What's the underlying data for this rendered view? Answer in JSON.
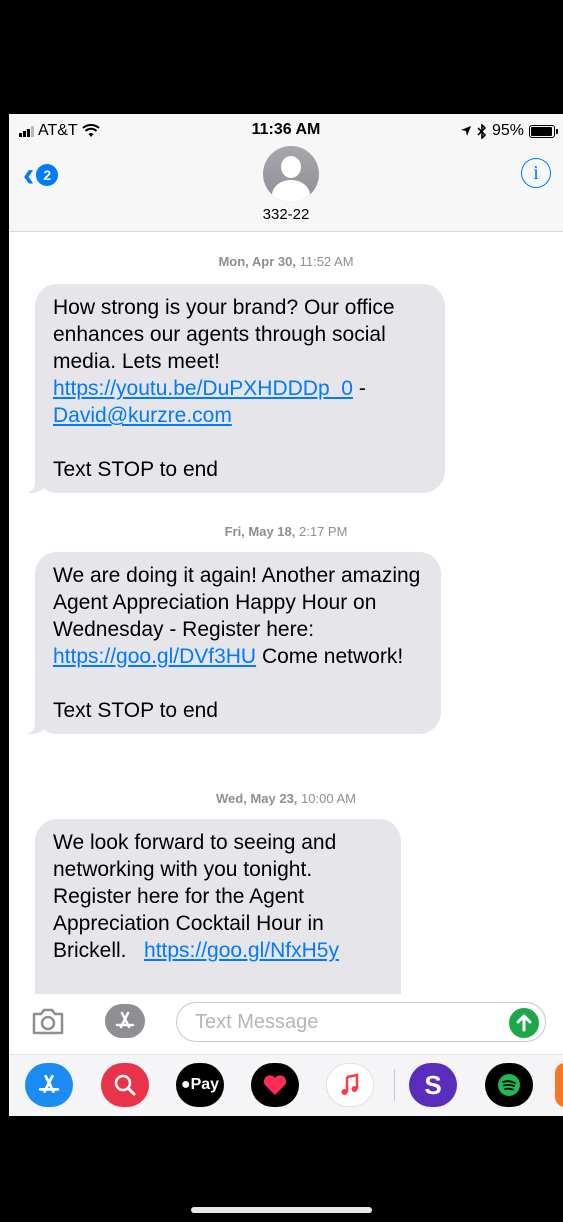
{
  "status_bar": {
    "carrier": "AT&T",
    "time": "11:36 AM",
    "battery": "95%",
    "battery_level": 0.95,
    "icons": [
      "signal-icon",
      "wifi-icon",
      "location-icon",
      "bluetooth-icon",
      "battery-icon"
    ]
  },
  "header": {
    "back_badge": "2",
    "contact_name": "332-22",
    "info_label": "i"
  },
  "messages": [
    {
      "timestamp_day": "Mon, Apr 30,",
      "timestamp_time": "11:52 AM",
      "text_before_link": "How strong is your brand? Our office enhances our agents through social media. Lets meet! ",
      "link1": "https://youtu.be/DuPXHDDDp_0",
      "text_between": " - ",
      "link2": "David@kurzre.com",
      "footer": "Text STOP to end"
    },
    {
      "timestamp_day": "Fri, May 18,",
      "timestamp_time": "2:17 PM",
      "text_before_link": "We are doing it again! Another amazing Agent Appreciation Happy Hour on Wednesday - Register here: ",
      "link1": "https://goo.gl/DVf3HU",
      "text_after_link": " Come network!",
      "footer": "Text STOP to end"
    },
    {
      "timestamp_day": "Wed, May 23,",
      "timestamp_time": "10:00 AM",
      "text_before_link": "We look forward to seeing and networking with you tonight. Register here for the Agent Appreciation Cocktail Hour in Brickell.   ",
      "link1": "https://goo.gl/NfxH5y"
    }
  ],
  "input": {
    "placeholder": "Text Message"
  },
  "app_drawer": {
    "apps": [
      "app-store-icon",
      "search-images-icon",
      "apple-pay-icon",
      "heart-icon",
      "music-icon",
      "s-app-icon",
      "spotify-icon"
    ],
    "apple_pay_label": "Pay"
  },
  "colors": {
    "accent": "#007aff",
    "bubble": "#e5e5ea",
    "send": "#1ca84a"
  }
}
